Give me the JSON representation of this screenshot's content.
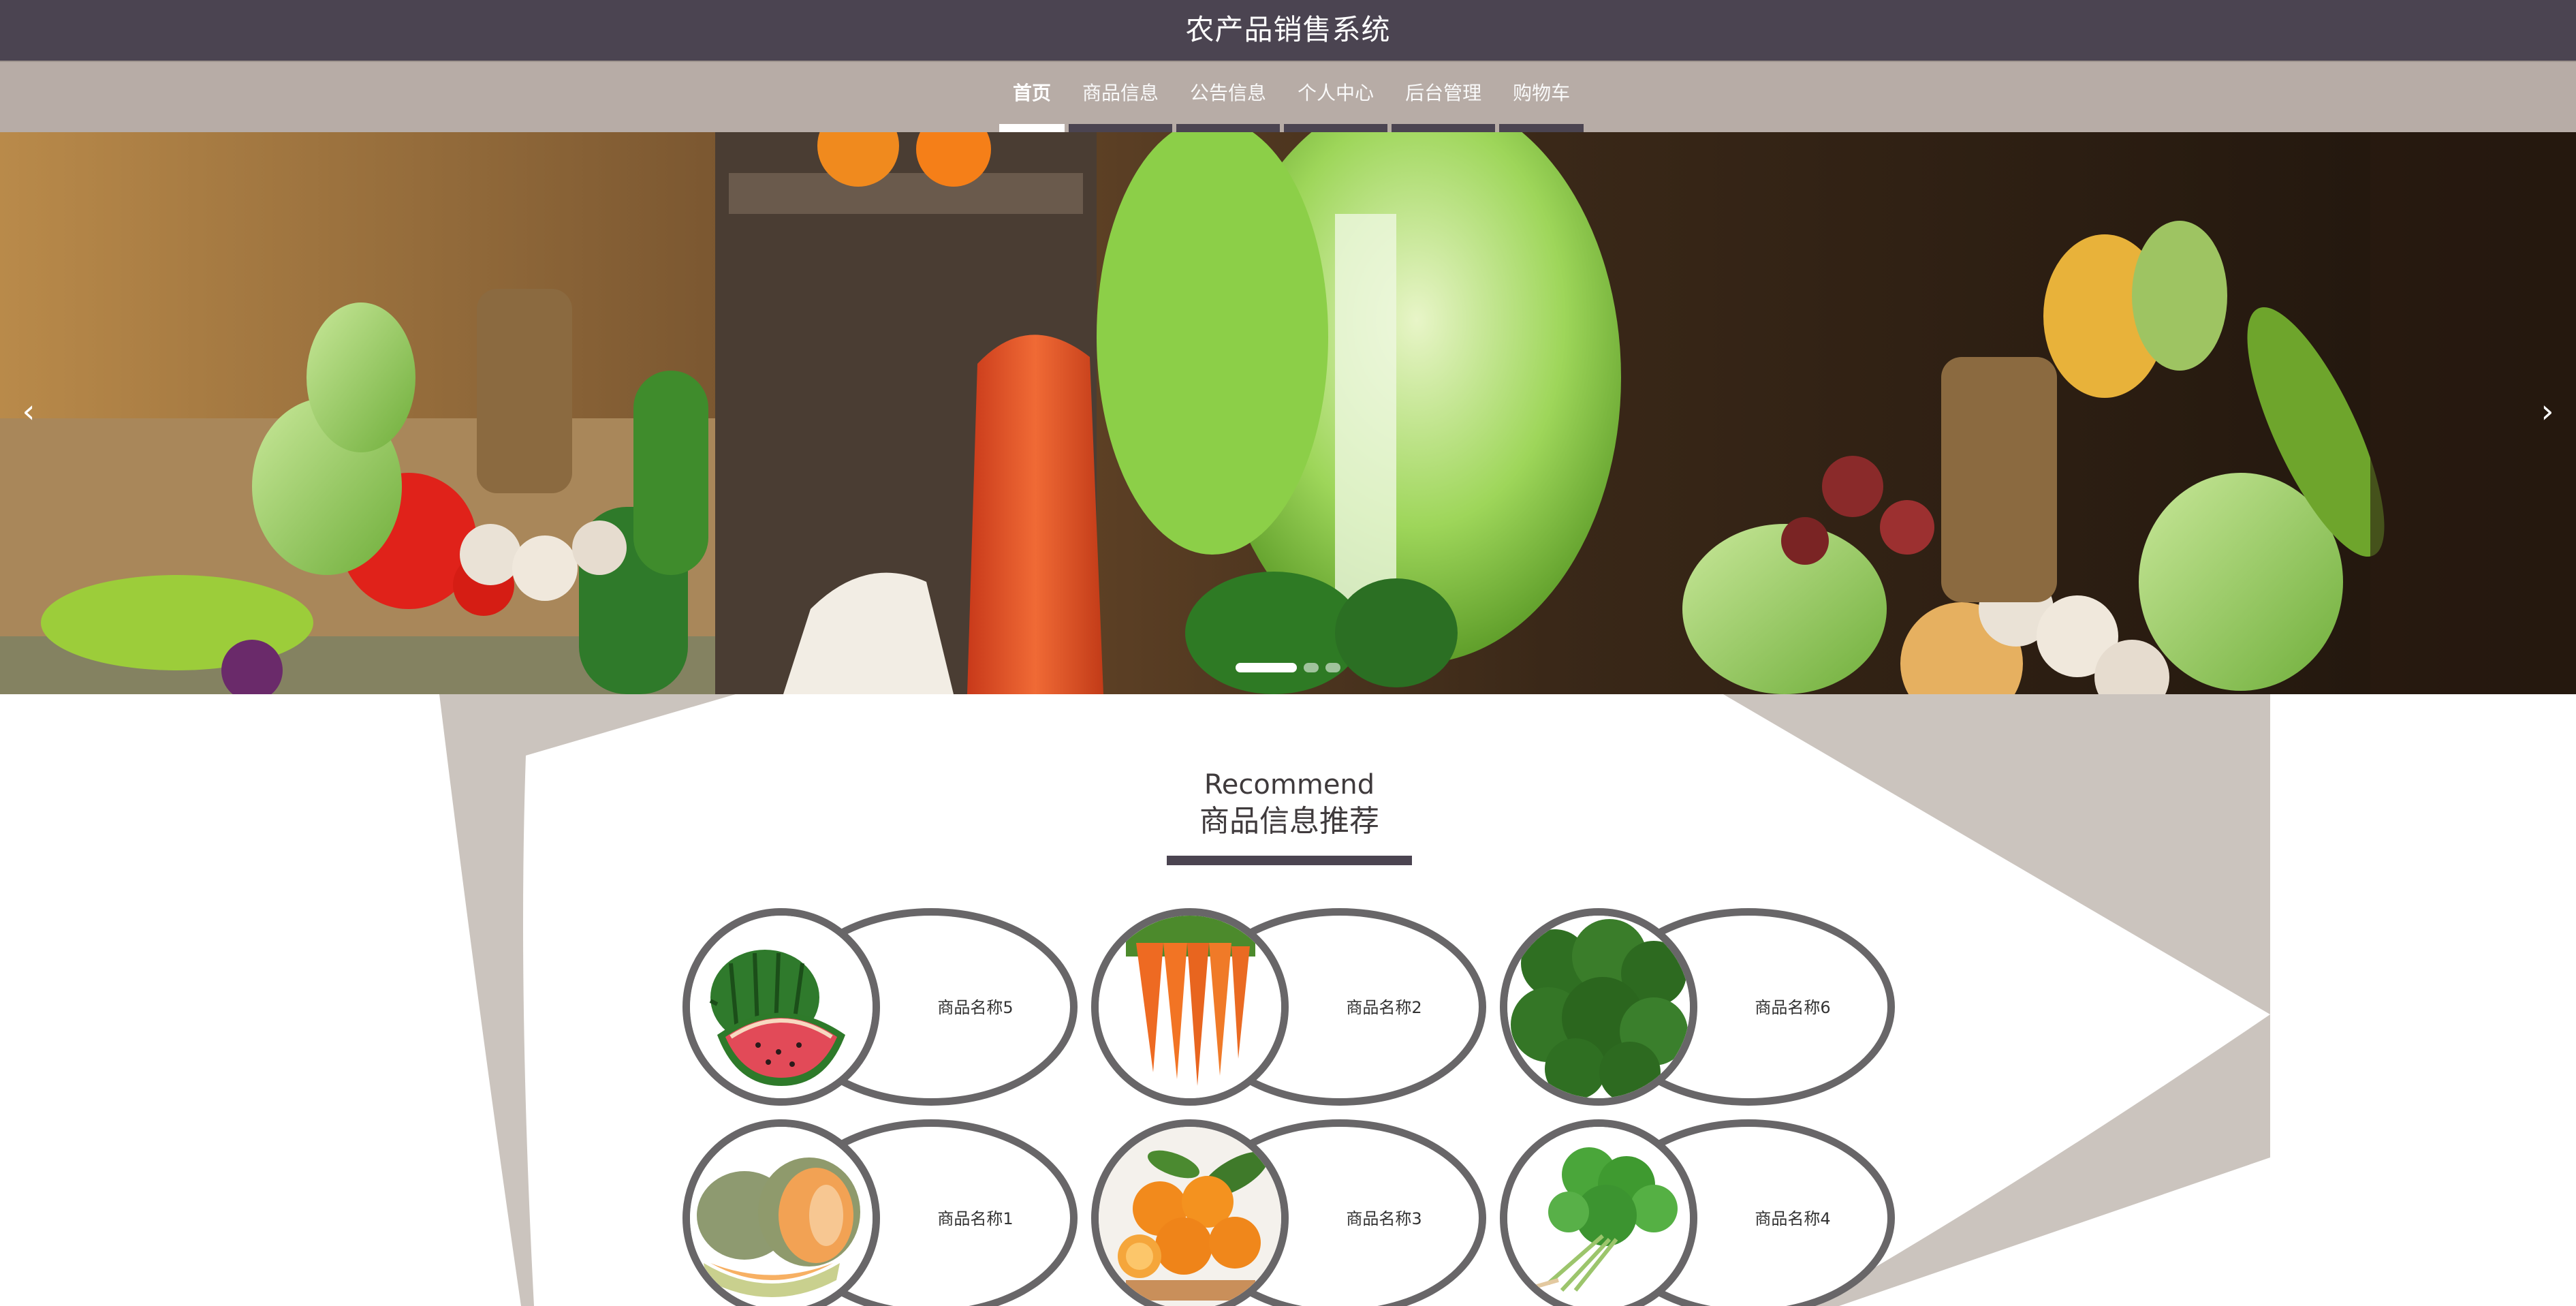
{
  "header": {
    "title": "农产品销售系统"
  },
  "nav": {
    "items": [
      {
        "label": "首页",
        "active": true
      },
      {
        "label": "商品信息",
        "active": false
      },
      {
        "label": "公告信息",
        "active": false
      },
      {
        "label": "个人中心",
        "active": false
      },
      {
        "label": "后台管理",
        "active": false
      },
      {
        "label": "购物车",
        "active": false
      }
    ]
  },
  "carousel": {
    "prev_icon": "‹",
    "next_icon": "›",
    "slide_count": 3,
    "active_slide": 1
  },
  "recommend": {
    "title_en": "Recommend",
    "title_cn": "商品信息推荐",
    "products": [
      {
        "name": "商品名称5",
        "image": "watermelon"
      },
      {
        "name": "商品名称2",
        "image": "carrots"
      },
      {
        "name": "商品名称6",
        "image": "broccoli"
      },
      {
        "name": "商品名称1",
        "image": "cantaloupe"
      },
      {
        "name": "商品名称3",
        "image": "oranges"
      },
      {
        "name": "商品名称4",
        "image": "cilantro"
      }
    ]
  },
  "colors": {
    "header_bg": "#4b4451",
    "nav_bg": "#b7aca6",
    "accent": "#4b4451",
    "card_border": "#686668",
    "section_shape": "#cbc4be"
  }
}
